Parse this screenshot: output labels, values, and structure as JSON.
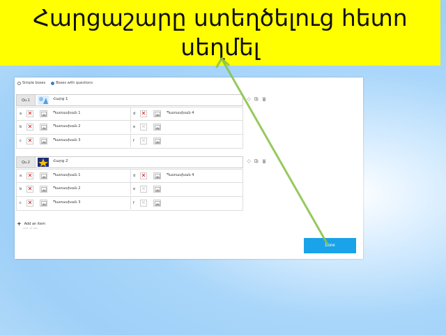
{
  "banner": {
    "text": "Հարցաշարը ստեղծելուց հետո սեղմել"
  },
  "radios": [
    {
      "label": "Simple boxes",
      "selected": false
    },
    {
      "label": "Boxes with questions",
      "selected": true
    }
  ],
  "questions": [
    {
      "label": "Qu.1",
      "text": "Հարց 1",
      "rows": [
        {
          "left": {
            "letter": "a",
            "text": "Պատասխան 1"
          },
          "right": {
            "letter": "d",
            "text": "Պատասխան 4"
          }
        },
        {
          "left": {
            "letter": "b",
            "text": "Պատասխան 2"
          },
          "right": {
            "letter": "e",
            "text": ""
          }
        },
        {
          "left": {
            "letter": "c",
            "text": "Պատասխան 3"
          },
          "right": {
            "letter": "f",
            "text": ""
          }
        }
      ]
    },
    {
      "label": "Qu.2",
      "text": "Հարց 2",
      "rows": [
        {
          "left": {
            "letter": "a",
            "text": "Պատասխան 1"
          },
          "right": {
            "letter": "d",
            "text": "Պատասխան 4"
          }
        },
        {
          "left": {
            "letter": "b",
            "text": "Պատասխան 2"
          },
          "right": {
            "letter": "e",
            "text": ""
          }
        },
        {
          "left": {
            "letter": "c",
            "text": "Պատասխան 3"
          },
          "right": {
            "letter": "f",
            "text": ""
          }
        }
      ]
    }
  ],
  "add_item": {
    "label": "Add an item",
    "sublabel": "Limit: 32 cells"
  },
  "done_button": {
    "label": "Done"
  },
  "colors": {
    "banner": "#ffff00",
    "accent": "#1aa3e8",
    "arrow": "#8bc34a",
    "delete": "#dd0000"
  },
  "icons": {
    "delete": "x-icon",
    "image": "image-icon",
    "move": "move-arrows-icon",
    "copy": "copy-icon",
    "trash": "trash-icon"
  }
}
